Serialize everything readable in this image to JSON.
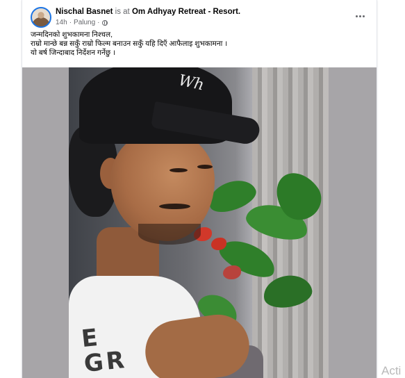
{
  "post": {
    "author_name": "Nischal Basnet",
    "location_connector": "is at",
    "location": "Om Adhyay Retreat - Resort.",
    "time": "14h",
    "separator": "·",
    "place": "Palung",
    "separator2": "·",
    "audience_icon": "globe-icon",
    "more_icon": "more-options-icon",
    "text_lines": [
      "जन्मदिनको शुभकामना निश्चल,",
      "राम्रो मान्छे बन्न सकुँ राम्रो फिल्म बनाउन सकुँ यहि दिएँ आफैलाइ शुभकामना ।",
      "यो बर्ष जिन्दाबाद निर्देशन गर्नेछु ।"
    ],
    "photo_alt_shirt_text": "E\nGR"
  },
  "os_overlay": {
    "watermark": "Acti"
  },
  "colors": {
    "accent": "#1b74e4",
    "text_primary": "#050505",
    "text_secondary": "#65676b",
    "photo_background": "#a7a5a8"
  }
}
